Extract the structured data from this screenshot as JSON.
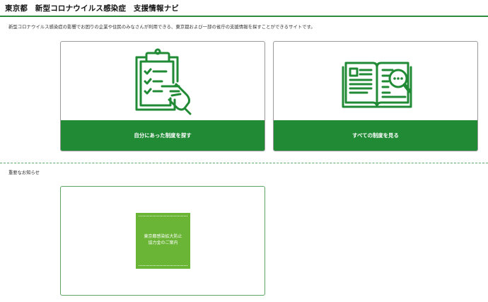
{
  "header": {
    "title": "東京都　新型コロナウイルス感染症　支援情報ナビ"
  },
  "intro": "新型コロナウイルス感染症の影響でお困りの企業や住民のみなさんが利用できる、東京都および一部の省庁の支援情報を探すことができるサイトです。",
  "cards": [
    {
      "label": "自分にあった制度を探す",
      "icon": "clipboard-pointing-hand-icon"
    },
    {
      "label": "すべての制度を見る",
      "icon": "open-book-magnifier-icon"
    }
  ],
  "notices": {
    "heading": "重要なお知らせ",
    "banner": {
      "line1": "東京都感染拡大防止",
      "line2": "協力金のご案内"
    }
  },
  "colors": {
    "accent": "#208a35",
    "banner": "#6bb536"
  }
}
